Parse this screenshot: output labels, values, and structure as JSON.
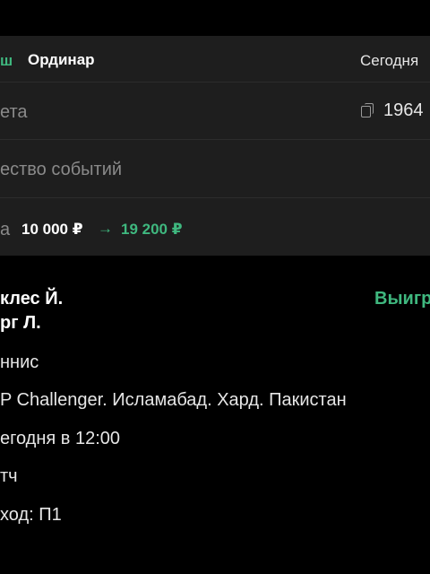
{
  "header": {
    "status": "ш",
    "type": "Ординар",
    "date": "Сегодня"
  },
  "ticket": {
    "label": "ета",
    "number": "1964"
  },
  "events_count": {
    "label": "ество событий"
  },
  "stake": {
    "label": "а",
    "amount": "10 000 ₽",
    "arrow": "→",
    "payout": "19 200 ₽"
  },
  "event": {
    "player1": "клес Й.",
    "player2": "рг Л.",
    "result": "Выигр",
    "sport": "ннис",
    "tournament": "P Challenger. Исламабад. Хард. Пакистан",
    "time": "егодня в 12:00",
    "market": "тч",
    "outcome": "ход: П1"
  }
}
